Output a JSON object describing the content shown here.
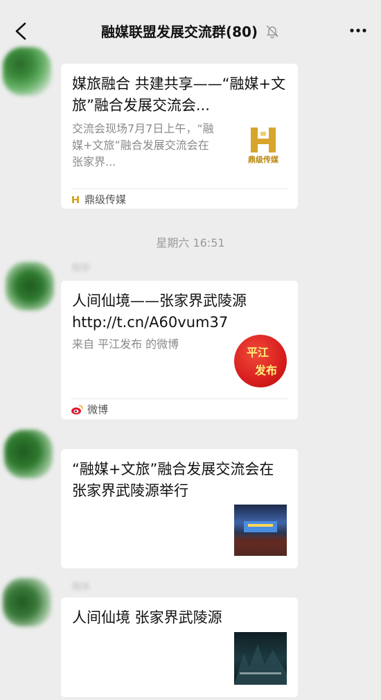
{
  "header": {
    "title": "融媒联盟发展交流群(80)",
    "back_icon": "chevron-left-icon",
    "mute_icon": "bell-off-icon",
    "more_icon": "ellipsis-icon"
  },
  "timestamp": "星期六 16:51",
  "messages": [
    {
      "sender": "",
      "title": "媒旅融合 共建共享——“融媒+文旅”融合发展交流会...",
      "desc": "交流会现场7月7日上午，“融媒+文旅”融合发展交流会在张家界...",
      "thumb_text": "鼎级传媒",
      "source": "鼎级传媒"
    },
    {
      "sender": "阳华",
      "title_line1": "人间仙境——张家界武陵源",
      "title_line2": "http://t.cn/A60vum37",
      "desc": "来自 平江发布 的微博",
      "thumb_text_1": "平江",
      "thumb_text_2": "发布",
      "source": "微博"
    },
    {
      "sender": "",
      "title": "“融媒+文旅”融合发展交流会在张家界武陵源举行"
    },
    {
      "sender": "阳华",
      "title": "人间仙境 张家界武陵源"
    }
  ]
}
